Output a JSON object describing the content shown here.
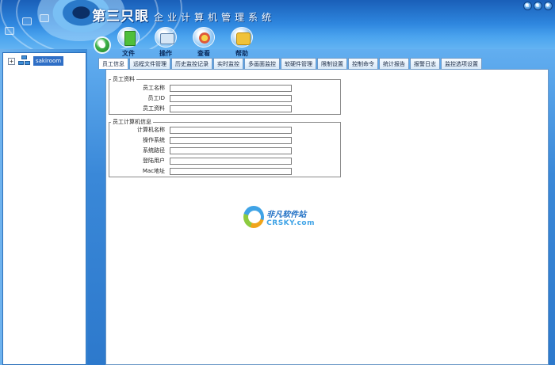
{
  "app": {
    "brand": "第三只眼",
    "subtitle": "企业计算机管理系统"
  },
  "window_controls": [
    "▫",
    "▫",
    "×"
  ],
  "toolbar": {
    "items": [
      {
        "label": "文件",
        "icon": "file-icon"
      },
      {
        "label": "操作",
        "icon": "operation-icon"
      },
      {
        "label": "查看",
        "icon": "view-icon"
      },
      {
        "label": "帮助",
        "icon": "help-icon"
      }
    ]
  },
  "tree": {
    "toggle": "+",
    "root_label": "sakiroom"
  },
  "tabs": [
    {
      "label": "员工信息",
      "active": true
    },
    {
      "label": "远程文件管理"
    },
    {
      "label": "历史监控记录"
    },
    {
      "label": "实时监控"
    },
    {
      "label": "多画面监控"
    },
    {
      "label": "软硬件管理"
    },
    {
      "label": "限制设置"
    },
    {
      "label": "控制命令"
    },
    {
      "label": "统计报告"
    },
    {
      "label": "报警日志"
    },
    {
      "label": "监控选项设置"
    }
  ],
  "employee_group": {
    "title": "员工资料",
    "fields": [
      {
        "label": "员工名称",
        "value": ""
      },
      {
        "label": "员工ID",
        "value": ""
      },
      {
        "label": "员工资料",
        "value": ""
      }
    ]
  },
  "computer_group": {
    "title": "员工计算机信息",
    "fields": [
      {
        "label": "计算机名称",
        "value": ""
      },
      {
        "label": "操作系统",
        "value": ""
      },
      {
        "label": "系统路径",
        "value": ""
      },
      {
        "label": "登陆用户",
        "value": ""
      },
      {
        "label": "Mac地址",
        "value": ""
      }
    ]
  },
  "watermark": {
    "cn": "非凡软件站",
    "en": "CRSKY.com"
  },
  "colors": {
    "header_blue": "#2e86de",
    "panel_bg": "#ffffff",
    "tab_border": "#6c98c7"
  }
}
